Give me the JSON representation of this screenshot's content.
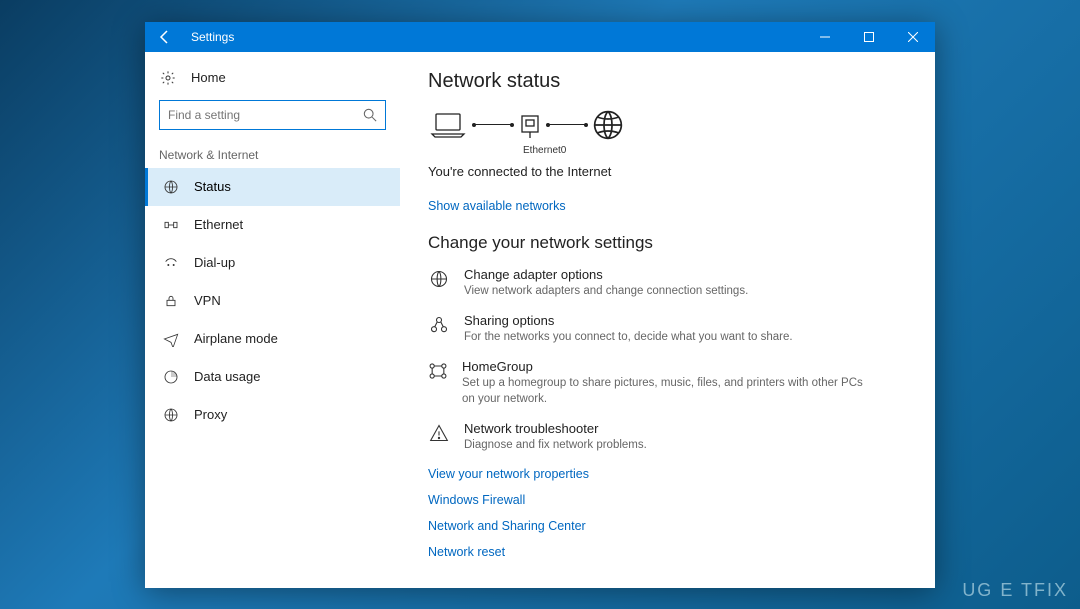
{
  "titlebar": {
    "title": "Settings"
  },
  "sidebar": {
    "home": "Home",
    "search_placeholder": "Find a setting",
    "category": "Network & Internet",
    "items": [
      {
        "label": "Status",
        "icon": "status"
      },
      {
        "label": "Ethernet",
        "icon": "ethernet"
      },
      {
        "label": "Dial-up",
        "icon": "dialup"
      },
      {
        "label": "VPN",
        "icon": "vpn"
      },
      {
        "label": "Airplane mode",
        "icon": "airplane"
      },
      {
        "label": "Data usage",
        "icon": "data"
      },
      {
        "label": "Proxy",
        "icon": "proxy"
      }
    ]
  },
  "main": {
    "heading": "Network status",
    "adapter_label": "Ethernet0",
    "status_text": "You're connected to the Internet",
    "show_networks": "Show available networks",
    "change_heading": "Change your network settings",
    "options": [
      {
        "title": "Change adapter options",
        "desc": "View network adapters and change connection settings."
      },
      {
        "title": "Sharing options",
        "desc": "For the networks you connect to, decide what you want to share."
      },
      {
        "title": "HomeGroup",
        "desc": "Set up a homegroup to share pictures, music, files, and printers with other PCs on your network."
      },
      {
        "title": "Network troubleshooter",
        "desc": "Diagnose and fix network problems."
      }
    ],
    "links": [
      "View your network properties",
      "Windows Firewall",
      "Network and Sharing Center",
      "Network reset"
    ]
  },
  "watermark": "UG E TFIX"
}
